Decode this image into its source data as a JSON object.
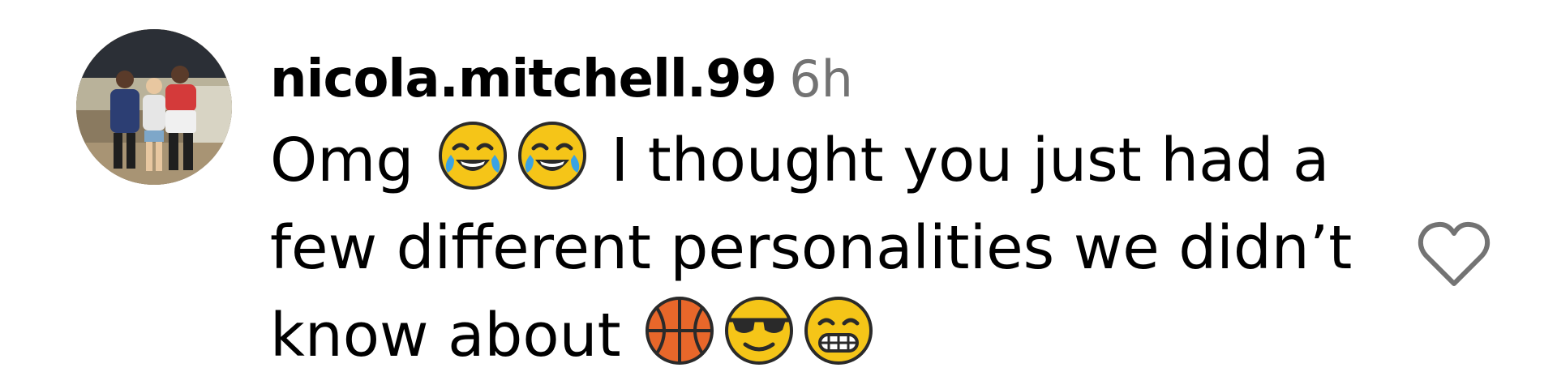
{
  "comment": {
    "username": "nicola.mitchell.99",
    "timestamp": "6h",
    "lines": [
      {
        "before": "Omg",
        "after": "I thought you just had a"
      },
      {
        "text": "few different personalities we didn’t"
      },
      {
        "text": "know about"
      }
    ],
    "emojis": {
      "line1": [
        "face-with-tears-of-joy",
        "face-with-tears-of-joy"
      ],
      "line3": [
        "basketball",
        "smiling-face-with-sunglasses",
        "grinning-face"
      ]
    }
  },
  "icons": {
    "like": "heart-outline-icon"
  },
  "colors": {
    "username": "#000000",
    "timestamp": "#737373",
    "text": "#000000",
    "heart_stroke": "#737373"
  }
}
